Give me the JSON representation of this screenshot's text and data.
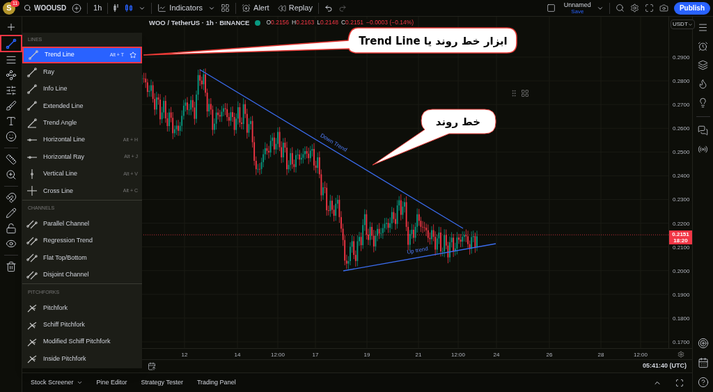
{
  "top_bar": {
    "avatar": "S",
    "notification_count": "11",
    "symbol": "WOOUSD",
    "interval": "1h",
    "indicators": "Indicators",
    "alert": "Alert",
    "replay": "Replay",
    "layout_name": "Unnamed",
    "save": "Save",
    "publish": "Publish"
  },
  "left_toolbar": [
    {
      "kind": "crosshair",
      "highlighted": false
    },
    {
      "kind": "trend-line",
      "highlighted": true
    },
    {
      "kind": "fib",
      "highlighted": false
    },
    {
      "kind": "pattern",
      "highlighted": false
    },
    {
      "kind": "projection",
      "highlighted": false
    },
    {
      "kind": "brush",
      "highlighted": false
    },
    {
      "kind": "text",
      "highlighted": false
    },
    {
      "kind": "emoji",
      "highlighted": false
    },
    {
      "kind": "ruler",
      "highlighted": false
    },
    {
      "kind": "zoom",
      "highlighted": false
    },
    {
      "kind": "magnet",
      "highlighted": false
    },
    {
      "kind": "pencil",
      "highlighted": false
    },
    {
      "kind": "lock",
      "highlighted": false
    },
    {
      "kind": "eye",
      "highlighted": false
    },
    {
      "kind": "trash",
      "highlighted": false
    }
  ],
  "legend": {
    "symbol": "WOO / TetherUS · 1h · BINANCE",
    "ohlc": [
      {
        "label": "O",
        "value": "0.2156"
      },
      {
        "label": "H",
        "value": "0.2163"
      },
      {
        "label": "L",
        "value": "0.2148"
      },
      {
        "label": "C",
        "value": "0.2151"
      }
    ],
    "change": "−0.0003 (−0.14%)"
  },
  "drawing_menu": {
    "sections": [
      {
        "header": "LINES",
        "items": [
          {
            "label": "Trend Line",
            "shortcut": "Alt + T",
            "selected": true,
            "highlighted": true,
            "kind": "diagonal"
          },
          {
            "label": "Ray",
            "selected": false,
            "highlighted": false,
            "kind": "diagonal"
          },
          {
            "label": "Info Line",
            "selected": false,
            "highlighted": false,
            "kind": "diagonal"
          },
          {
            "label": "Extended Line",
            "selected": false,
            "highlighted": false,
            "kind": "diagonal"
          },
          {
            "label": "Trend Angle",
            "selected": false,
            "highlighted": false,
            "kind": "angle"
          },
          {
            "label": "Horizontal Line",
            "shortcut": "Alt + H",
            "selected": false,
            "highlighted": false,
            "kind": "horizontal"
          },
          {
            "label": "Horizontal Ray",
            "shortcut": "Alt + J",
            "selected": false,
            "highlighted": false,
            "kind": "horizontal"
          },
          {
            "label": "Vertical Line",
            "shortcut": "Alt + V",
            "selected": false,
            "highlighted": false,
            "kind": "vertical"
          },
          {
            "label": "Cross Line",
            "shortcut": "Alt + C",
            "selected": false,
            "highlighted": false,
            "kind": "cross"
          }
        ]
      },
      {
        "header": "CHANNELS",
        "items": [
          {
            "label": "Parallel Channel",
            "selected": false,
            "highlighted": false,
            "kind": "channel"
          },
          {
            "label": "Regression Trend",
            "selected": false,
            "highlighted": false,
            "kind": "channel"
          },
          {
            "label": "Flat Top/Bottom",
            "selected": false,
            "highlighted": false,
            "kind": "channel"
          },
          {
            "label": "Disjoint Channel",
            "selected": false,
            "highlighted": false,
            "kind": "channel"
          }
        ]
      },
      {
        "header": "PITCHFORKS",
        "items": [
          {
            "label": "Pitchfork",
            "selected": false,
            "highlighted": false,
            "kind": "fork"
          },
          {
            "label": "Schiff Pitchfork",
            "selected": false,
            "highlighted": false,
            "kind": "fork"
          },
          {
            "label": "Modified Schiff Pitchfork",
            "selected": false,
            "highlighted": false,
            "kind": "fork"
          },
          {
            "label": "Inside Pitchfork",
            "selected": false,
            "highlighted": false,
            "kind": "fork"
          }
        ]
      }
    ]
  },
  "chart": {
    "annotations": [
      {
        "text": "Down Trend"
      },
      {
        "text": "Up trend"
      }
    ],
    "callouts": [
      {
        "text": "ابزار خط روند یا Trend Line"
      },
      {
        "text": "خط روند"
      }
    ]
  },
  "price_axis": {
    "currency": "USDT",
    "labels": [
      "0.2900",
      "0.2800",
      "0.2700",
      "0.2600",
      "0.2500",
      "0.2400",
      "0.2300",
      "0.2200",
      "0.2100",
      "0.2000",
      "0.1900",
      "0.1800",
      "0.1700"
    ],
    "last_price": "0.2151",
    "countdown": "18:20"
  },
  "time_axis": {
    "labels": [
      "12",
      "14",
      "12:00",
      "17",
      "19",
      "21",
      "12:00",
      "24",
      "26",
      "28",
      "12:00"
    ]
  },
  "status": {
    "clock": "05:41:40 (UTC)"
  },
  "bottom_tabs": [
    {
      "label": "Stock Screener",
      "has_menu": true
    },
    {
      "label": "Pine Editor",
      "has_menu": false
    },
    {
      "label": "Strategy Tester",
      "has_menu": false
    },
    {
      "label": "Trading Panel",
      "has_menu": false
    }
  ]
}
